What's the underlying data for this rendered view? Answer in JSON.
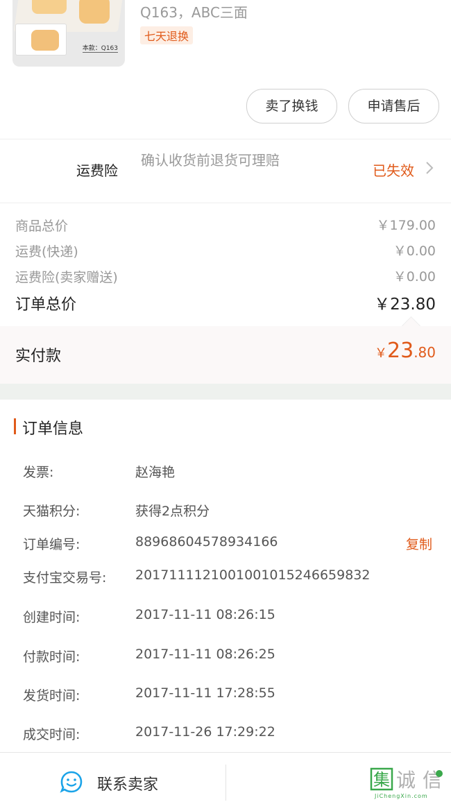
{
  "product": {
    "description": "Q163，ABC三面",
    "return_tag": "七天退换",
    "thumbnail_model_text": "本款：Q163"
  },
  "actions": {
    "sell_label": "卖了换钱",
    "after_sale_label": "申请售后"
  },
  "insurance": {
    "title": "运费险",
    "description": "确认收货前退货可理赔",
    "status": "已失效"
  },
  "prices": {
    "goods_label": "商品总价",
    "goods_value": "￥179.00",
    "shipping_label": "运费(快递)",
    "shipping_value": "￥0.00",
    "insurance_label": "运费险(卖家赠送)",
    "insurance_value": "￥0.00",
    "order_total_label": "订单总价",
    "order_total_value": "￥23.80",
    "paid_label": "实付款",
    "paid_currency": "￥",
    "paid_integer": "23",
    "paid_decimal": ".80"
  },
  "order_info": {
    "title": "订单信息",
    "rows": [
      {
        "label": "发票:",
        "value": "赵海艳"
      },
      {
        "label": "天猫积分:",
        "value": "获得2点积分"
      },
      {
        "label": "订单编号:",
        "value": "88968604578934166"
      },
      {
        "label": "支付宝交易号:",
        "value": "2017111121001001015246659832"
      },
      {
        "label": "创建时间:",
        "value": "2017-11-11 08:26:15"
      },
      {
        "label": "付款时间:",
        "value": "2017-11-11 08:26:25"
      },
      {
        "label": "发货时间:",
        "value": "2017-11-11 17:28:55"
      },
      {
        "label": "成交时间:",
        "value": "2017-11-26 17:29:22"
      }
    ],
    "copy_label": "复制"
  },
  "bottom": {
    "contact_label": "联系卖家"
  },
  "watermark": {
    "text": "集诚信",
    "url_text": "JiChengXin.com"
  },
  "colors": {
    "accent": "#e05a1a",
    "muted": "#999999",
    "icon_blue": "#1aa3e8"
  }
}
